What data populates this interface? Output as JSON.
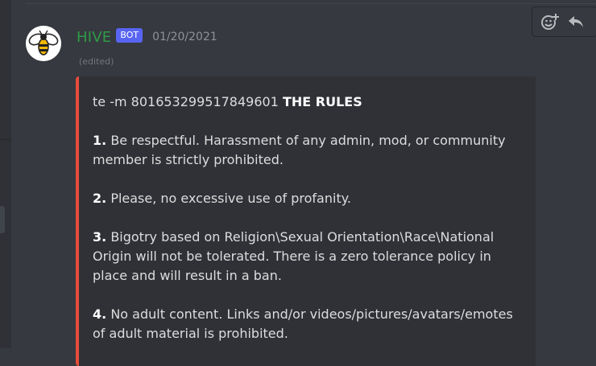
{
  "colors": {
    "background": "#36393f",
    "embed_background": "#2f3136",
    "embed_accent": "#e74c3c",
    "username": "#2e9b47",
    "bot_tag": "#5865f2"
  },
  "toolbar": {
    "icons": [
      "add-reaction-icon",
      "reply-icon"
    ]
  },
  "message": {
    "author": "HIVE",
    "bot_tag": "BOT",
    "timestamp": "01/20/2021",
    "edited": "(edited)",
    "avatar": "bee-avatar-icon"
  },
  "embed": {
    "prefix": "te -m 801653299517849601",
    "title": "THE RULES",
    "rules": [
      {
        "num": "1.",
        "text": "Be respectful. Harassment of any admin, mod, or community member is strictly prohibited."
      },
      {
        "num": "2.",
        "text": "Please, no excessive use of profanity."
      },
      {
        "num": "3.",
        "text": "Bigotry based on Religion\\Sexual Orientation\\Race\\National Origin will not be tolerated. There is a zero tolerance policy in place and will result in a ban."
      },
      {
        "num": "4.",
        "text": "No adult content. Links and/or videos/pictures/avatars/emotes of adult material is prohibited."
      }
    ]
  }
}
